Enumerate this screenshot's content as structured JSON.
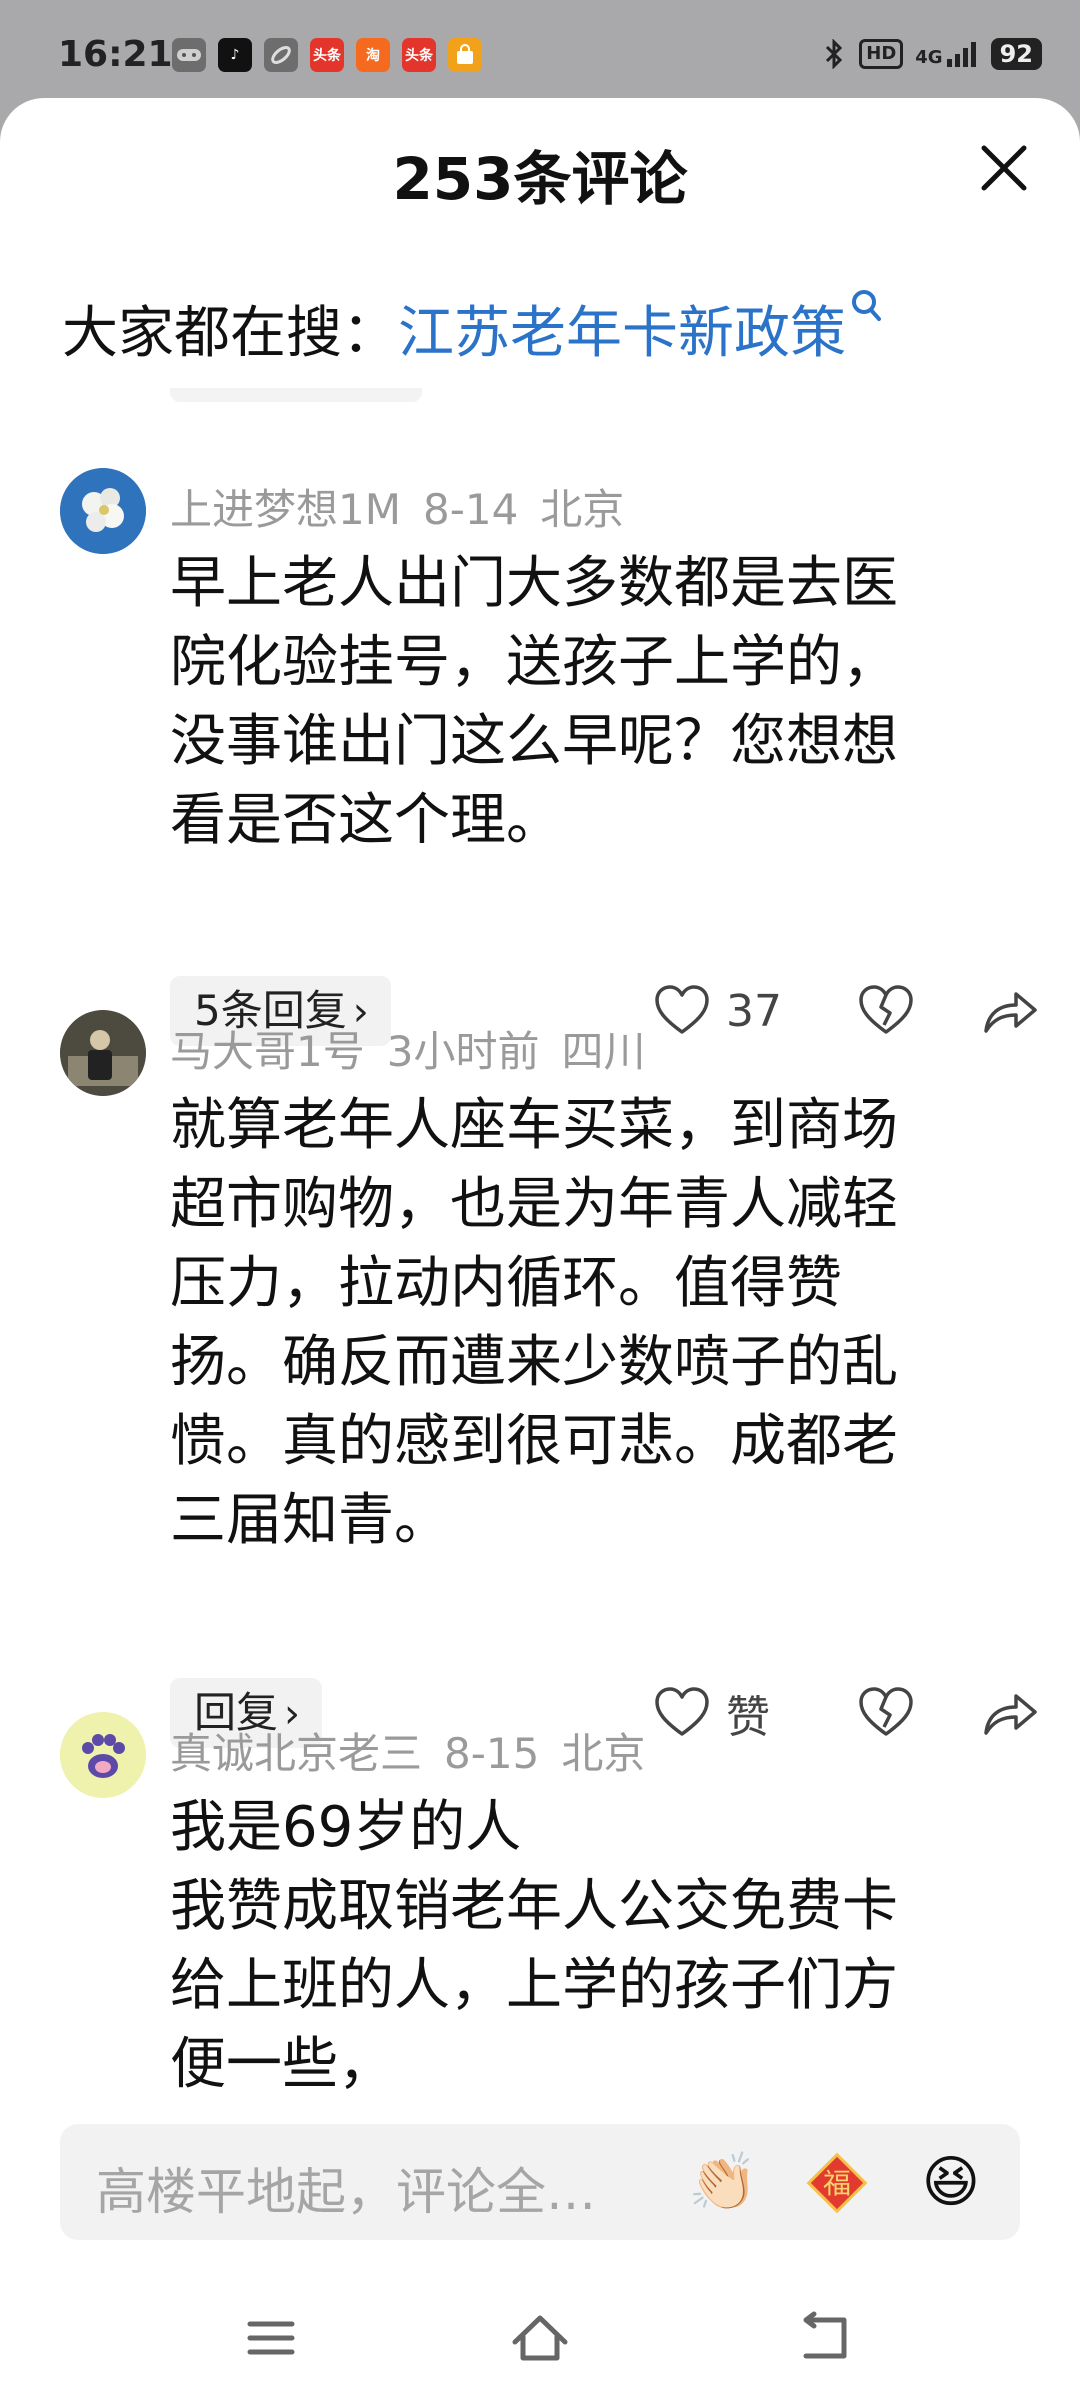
{
  "status_bar": {
    "time": "16:21",
    "apps": [
      {
        "icon": "game-controller-icon",
        "label": "",
        "color": "#555555"
      },
      {
        "icon": "tiktok-icon",
        "label": "♪",
        "color": "#111111"
      },
      {
        "icon": "link-icon",
        "label": "",
        "color": "#555555"
      },
      {
        "icon": "toutiao-icon",
        "label": "头条",
        "color": "#e3352b"
      },
      {
        "icon": "taobao-icon",
        "label": "淘",
        "color": "#f56a1e"
      },
      {
        "icon": "toutiao-icon",
        "label": "头条",
        "color": "#e3352b"
      },
      {
        "icon": "bag-icon",
        "label": "",
        "color": "#f2a21a"
      }
    ],
    "hd": "HD",
    "network": "4G",
    "battery": "92"
  },
  "sheet": {
    "title": "253条评论"
  },
  "hot_search": {
    "prefix": "大家都在搜：",
    "keyword": "江苏老年卡新政策"
  },
  "comments": [
    {
      "user": "上进梦想1M",
      "date": "8-14",
      "location": "北京",
      "lines": [
        "早上老人出门大多数都是去医",
        "院化验挂号，送孩子上学的，",
        "没事谁出门这么早呢？您想想",
        "看是否这个理。"
      ],
      "reply_label": "5条回复",
      "like_label": "37"
    },
    {
      "user": "马大哥1号",
      "date": "3小时前",
      "location": "四川",
      "lines": [
        "就算老年人座车买菜，到商场",
        "超市购物，也是为年青人减轻",
        "压力，拉动内循环。值得赞",
        "扬。确反而遭来少数喷子的乱",
        "愦。真的感到很可悲。成都老",
        "三届知青。"
      ],
      "reply_label": "回复",
      "like_label": "赞"
    },
    {
      "user": "真诚北京老三",
      "date": "8-15",
      "location": "北京",
      "lines": [
        "我是69岁的人",
        "我赞成取销老年人公交免费卡",
        "给上班的人，上学的孩子们方",
        "便一些，"
      ]
    }
  ],
  "input_bar": {
    "placeholder": "高楼平地起，评论全…",
    "emojis": [
      "👏🏻",
      "福",
      "😆"
    ]
  },
  "colors": {
    "link": "#2b73c8",
    "meta": "#9a9a9a",
    "status_bg": "#a9a9ab"
  }
}
